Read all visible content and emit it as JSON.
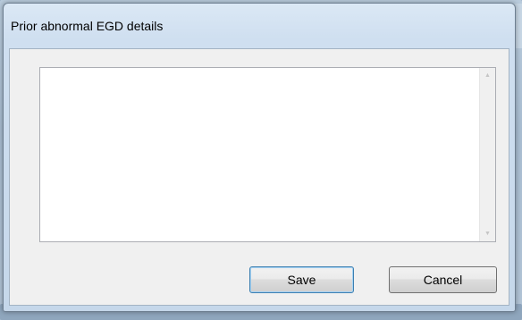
{
  "window": {
    "title": "Prior abnormal EGD details"
  },
  "details": {
    "value": ""
  },
  "scrollbar": {
    "up_glyph": "▲",
    "down_glyph": "▼"
  },
  "buttons": {
    "save_label": "Save",
    "cancel_label": "Cancel"
  },
  "icons": {
    "scroll_up": "scroll-up-arrow-icon",
    "scroll_down": "scroll-down-arrow-icon"
  },
  "colors": {
    "frame": "#cfdff0",
    "client": "#f0f0f0",
    "default_button_border": "#3c7fb1"
  }
}
